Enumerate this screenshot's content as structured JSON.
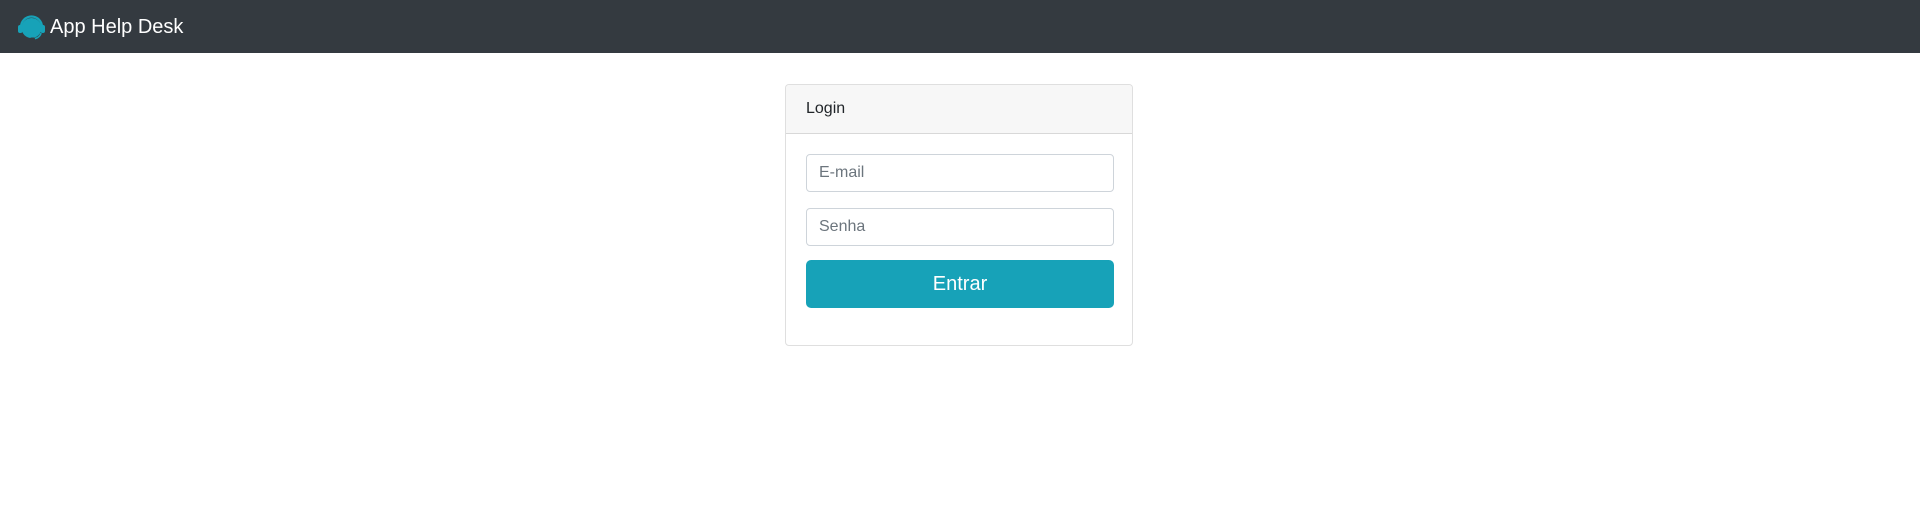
{
  "navbar": {
    "brand_icon": "headset-logo-icon",
    "brand_text": "App Help Desk"
  },
  "login_card": {
    "title": "Login",
    "email_placeholder": "E-mail",
    "password_placeholder": "Senha",
    "submit_label": "Entrar"
  },
  "colors": {
    "navbar_bg": "#343a40",
    "accent": "#17a2b8",
    "card_header_bg": "#f7f7f7"
  }
}
